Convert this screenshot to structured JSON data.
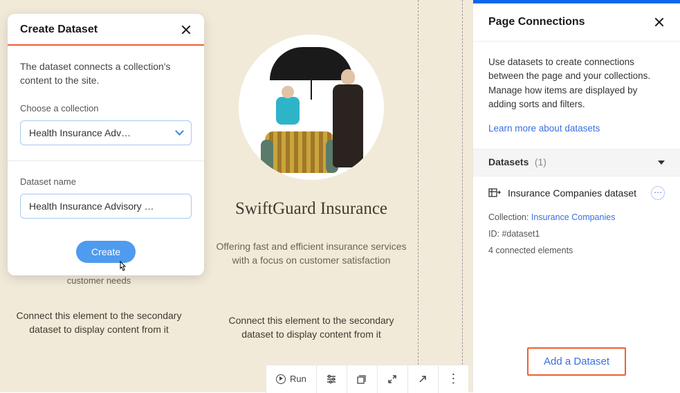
{
  "modal": {
    "title": "Create Dataset",
    "description": "The dataset connects a collection's content to the site.",
    "collection_label": "Choose a collection",
    "collection_value": "Health Insurance Adv…",
    "name_label": "Dataset name",
    "name_value": "Health Insurance Advisory …",
    "create_label": "Create"
  },
  "canvas": {
    "company_title": "SwiftGuard Insurance",
    "company_desc": "Offering fast and efficient insurance services with a focus on customer satisfaction",
    "left_snippet": "customer needs",
    "connect_text": "Connect this element to the secondary dataset to display content from it"
  },
  "toolbar": {
    "run_label": "Run"
  },
  "panel": {
    "title": "Page Connections",
    "intro": "Use datasets to create connections between the page and your collections. Manage how items are displayed by adding sorts and filters.",
    "learn_more": "Learn more about datasets",
    "datasets_label": "Datasets",
    "datasets_count": "(1)",
    "item_name": "Insurance Companies dataset",
    "collection_label": "Collection: ",
    "collection_link": "Insurance Companies",
    "id_label": "ID: ",
    "id_value": "#dataset1",
    "connected_elements": "4 connected elements",
    "add_label": "Add a Dataset"
  }
}
